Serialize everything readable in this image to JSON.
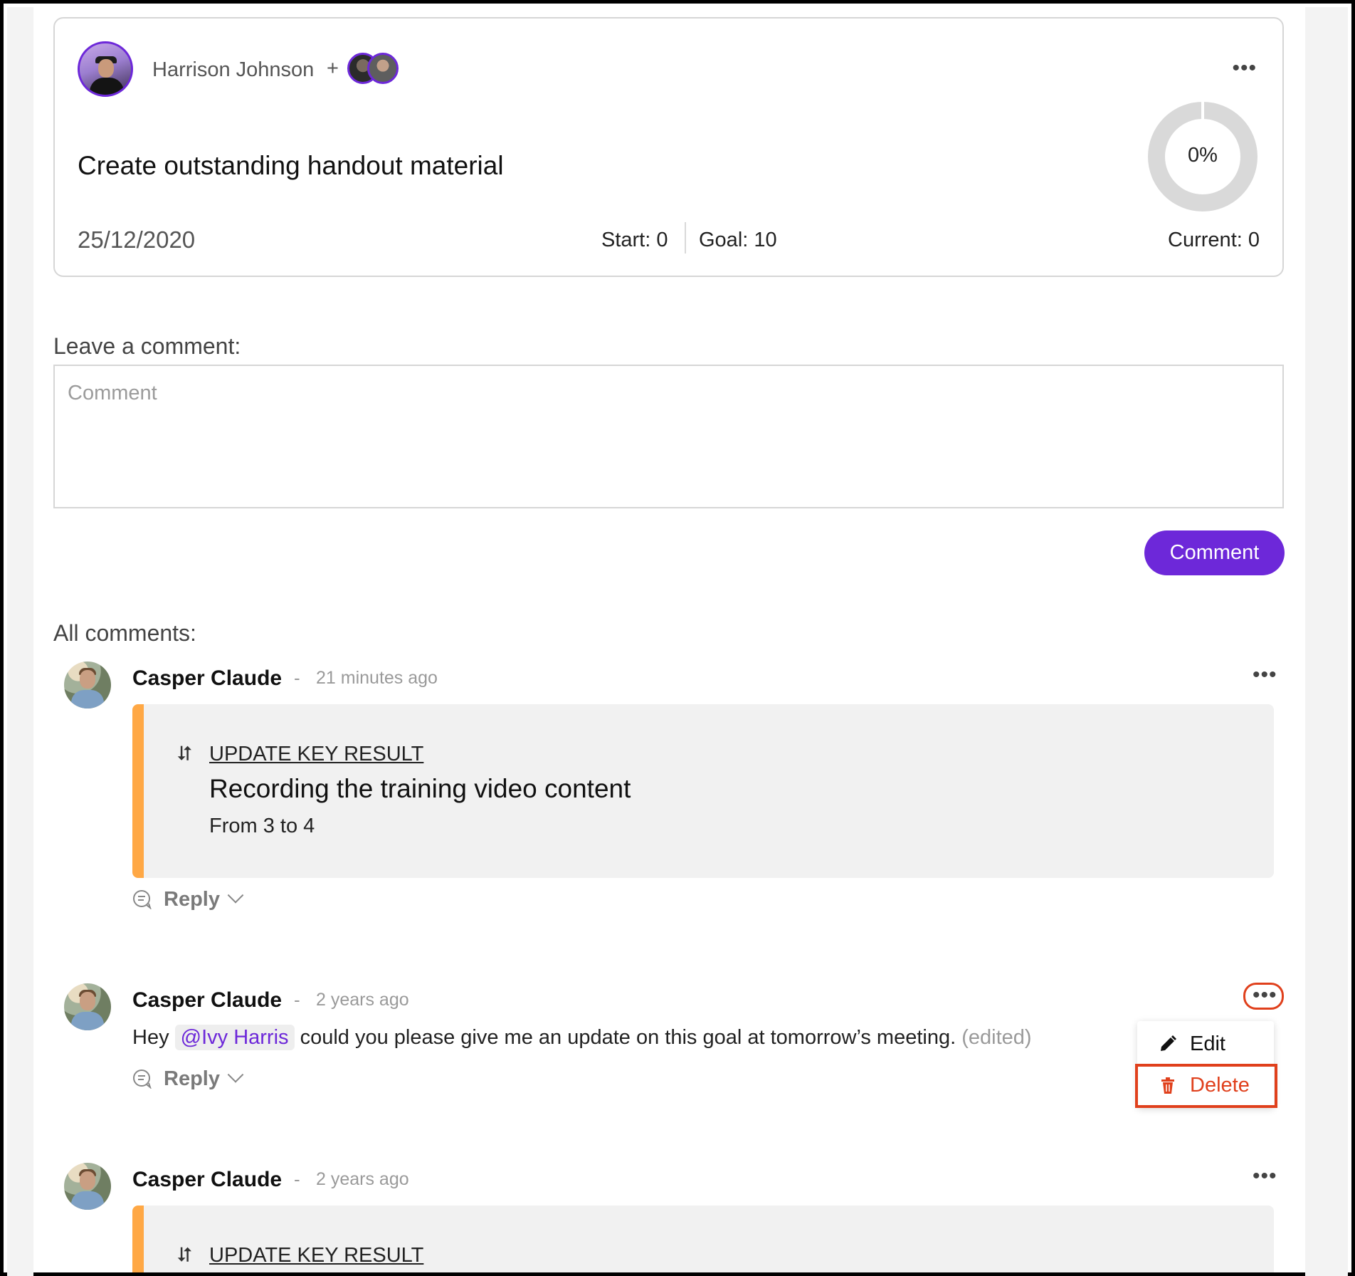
{
  "goal": {
    "owner": "Harrison Johnson",
    "plus": "+",
    "title": "Create outstanding handout material",
    "date": "25/12/2020",
    "start": "Start: 0",
    "goal": "Goal: 10",
    "current": "Current: 0",
    "progress_label": "0%",
    "progress": 0,
    "menu": "•••"
  },
  "form": {
    "label": "Leave a comment:",
    "placeholder": "Comment",
    "button": "Comment"
  },
  "comments_label": "All comments:",
  "comments": [
    {
      "author": "Casper Claude",
      "dash": "-",
      "time": "21 minutes ago",
      "menu": "•••",
      "kr_link": "UPDATE KEY RESULT",
      "kr_title": "Recording the training video content",
      "kr_change": "From 3 to 4",
      "reply": "Reply"
    },
    {
      "author": "Casper Claude",
      "dash": "-",
      "time": "2 years ago",
      "menu": "•••",
      "text_before": "Hey ",
      "mention": "@Ivy Harris",
      "text_after": " could you please give me an update on this goal at tomorrow’s meeting. ",
      "edited": "(edited)",
      "reply": "Reply"
    },
    {
      "author": "Casper Claude",
      "dash": "-",
      "time": "2 years ago",
      "menu": "•••",
      "kr_link": "UPDATE KEY RESULT"
    }
  ],
  "dropdown": {
    "edit": "Edit",
    "delete": "Delete"
  },
  "colors": {
    "accent": "#6d28d9",
    "danger": "#e0401c",
    "kr_bar": "#ffa845"
  },
  "icons": {
    "refresh": "⮃"
  }
}
